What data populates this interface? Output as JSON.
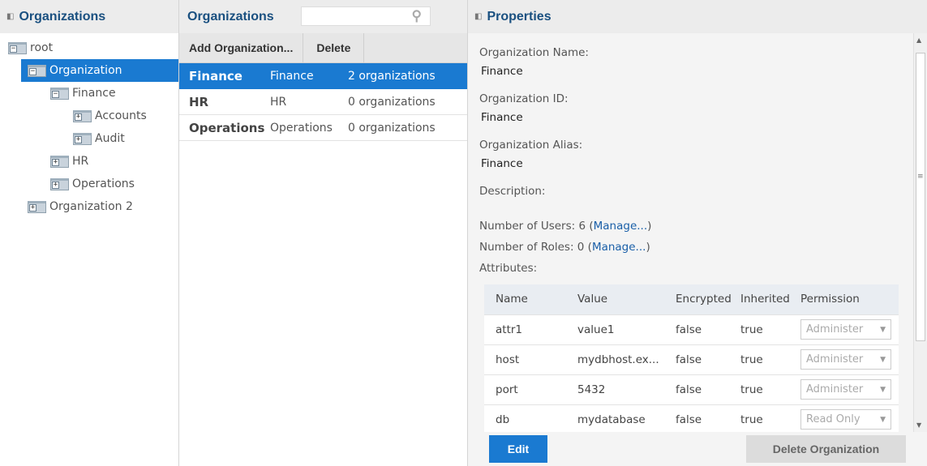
{
  "left": {
    "title": "Organizations",
    "tree": [
      {
        "label": "root",
        "depth": 0,
        "expanded": true,
        "selected": false
      },
      {
        "label": "Organization",
        "depth": 1,
        "expanded": true,
        "selected": true
      },
      {
        "label": "Finance",
        "depth": 2,
        "expanded": true,
        "selected": false
      },
      {
        "label": "Accounts",
        "depth": 3,
        "expanded": false,
        "selected": false
      },
      {
        "label": "Audit",
        "depth": 3,
        "expanded": false,
        "selected": false
      },
      {
        "label": "HR",
        "depth": 2,
        "expanded": false,
        "selected": false
      },
      {
        "label": "Operations",
        "depth": 2,
        "expanded": false,
        "selected": false
      },
      {
        "label": "Organization 2",
        "depth": 1,
        "expanded": false,
        "selected": false
      }
    ]
  },
  "mid": {
    "title": "Organizations",
    "search_placeholder": "",
    "add_label": "Add Organization...",
    "delete_label": "Delete",
    "rows": [
      {
        "name": "Finance",
        "id": "Finance",
        "count": "2 organizations",
        "selected": true
      },
      {
        "name": "HR",
        "id": "HR",
        "count": "0 organizations",
        "selected": false
      },
      {
        "name": "Operations",
        "id": "Operations",
        "count": "0 organizations",
        "selected": false
      }
    ]
  },
  "right": {
    "title": "Properties",
    "name_label": "Organization Name:",
    "name_value": "Finance",
    "id_label": "Organization ID:",
    "id_value": "Finance",
    "alias_label": "Organization Alias:",
    "alias_value": "Finance",
    "desc_label": "Description:",
    "users_label": "Number of Users: 6 (",
    "users_link": "Manage...",
    "users_close": ")",
    "roles_label": "Number of Roles: 0 (",
    "roles_link": "Manage...",
    "roles_close": ")",
    "attrs_label": "Attributes:",
    "attr_headers": [
      "Name",
      "Value",
      "Encrypted",
      "Inherited",
      "Permission"
    ],
    "attrs": [
      {
        "name": "attr1",
        "value": "value1",
        "encrypted": "false",
        "inherited": "true",
        "permission": "Administer"
      },
      {
        "name": "host",
        "value": "mydbhost.ex...",
        "encrypted": "false",
        "inherited": "true",
        "permission": "Administer"
      },
      {
        "name": "port",
        "value": "5432",
        "encrypted": "false",
        "inherited": "true",
        "permission": "Administer"
      },
      {
        "name": "db",
        "value": "mydatabase",
        "encrypted": "false",
        "inherited": "true",
        "permission": "Read Only"
      }
    ],
    "edit_label": "Edit",
    "delete_org_label": "Delete Organization"
  }
}
